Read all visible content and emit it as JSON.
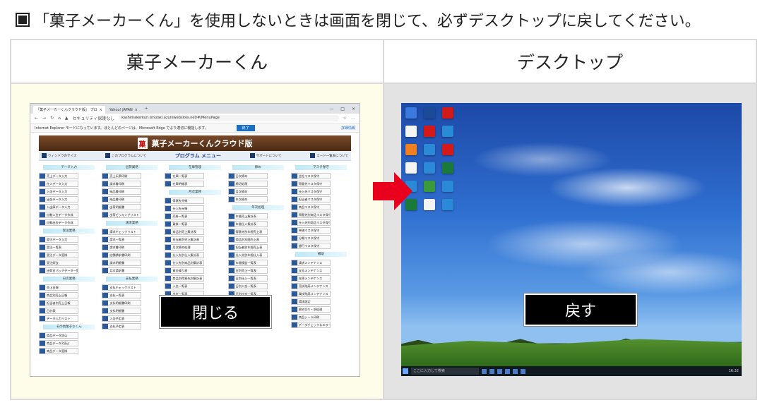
{
  "instruction": "「菓子メーカーくん」を使用しないときは画面を閉じて、必ずデスクトップに戻してください。",
  "table": {
    "left_header": "菓子メーカーくん",
    "right_header": "デスクトップ"
  },
  "browser": {
    "tabs": [
      "「菓子メーカーくんクラウド版」 プロ",
      "Yahoo! JAPAN"
    ],
    "security_label": "セキュリティ保護なし",
    "url": "kashimakerkun.ishizaki.azurewebsites.net/#/MenuPage",
    "ie_notice": "Internet Explorer モードになっています。ほとんどのページは、Microsoft Edge でより適切に機能します。",
    "ie_button": "終了",
    "ie_link": "詳細情報",
    "banner_title": "菓子メーカーくんクラウド版",
    "logo_char": "菓",
    "nav_items": [
      "ウィンドウのサイズ",
      "このプログラムについて",
      "プログラム メニュー",
      "サポートについて",
      "コード一覧表について"
    ],
    "columns": [
      {
        "sections": [
          {
            "title": "データ入力",
            "items": [
              "売上データ入力",
              "仕入データ入力",
              "入金データ入力",
              "出金データ入力",
              "入出庫データ入力",
              "自動入金データ作成",
              "自動出金データ作成"
            ]
          },
          {
            "title": "受注業務",
            "items": [
              "受注データ入力",
              "受注一覧表",
              "受注データ変換",
              "受注照会",
              "出荷日パッチデータ一覧"
            ]
          },
          {
            "title": "日次業務",
            "items": [
              "売上日報",
              "商品別売上日報",
              "担当者別売上日報",
              "日計表",
              "データ入力リスト"
            ]
          },
          {
            "title": "その他菓子なくん",
            "items": [
              "商品データ読込",
              "商品データ2読込",
              "商品データ変換"
            ]
          }
        ]
      },
      {
        "sections": [
          {
            "title": "出荷業務",
            "items": [
              "売上伝票印刷",
              "請求書印刷",
              "納品書印刷",
              "納品書印刷",
              "出荷明細書",
              "出荷ピッキングリスト"
            ]
          },
          {
            "title": "請求業務",
            "items": [
              "請求チェックリスト",
              "請求一覧表",
              "請求書印刷",
              "店舗請求書印刷",
              "請求明細書",
              "月次請求書"
            ]
          },
          {
            "title": "支払業務",
            "items": [
              "支払チェックリスト",
              "支払一覧表",
              "支払明細書印刷",
              "支払明細書",
              "入金予定表",
              "支払予定表"
            ]
          }
        ]
      },
      {
        "sections": [
          {
            "title": "在庫管理",
            "items": [
              "在庫一覧表",
              "在庫明細表"
            ]
          },
          {
            "title": "月次業務",
            "items": [
              "得意先元帳",
              "仕入先元帳",
              "売掛一覧表",
              "買掛一覧表",
              "商品別売上集計表",
              "担当者別売上集計表",
              "月次締め処理",
              "仕入先別仕入集計表",
              "仕入先別商品別集計表",
              "資金繰り表",
              "商品別得意先別集計表",
              "入金一覧表",
              "出金一覧表"
            ]
          }
        ]
      },
      {
        "sections": [
          {
            "title": "締め",
            "items": [
              "日次締め",
              "締切処理",
              "月次締め",
              "年次締め"
            ]
          },
          {
            "title": "年次処理",
            "items": [
              "年間売上集計表",
              "年間仕入集計表",
              "得意先別年間売上表",
              "商品別年間売上表",
              "担当者別年間売上表",
              "仕入先別年間仕入表",
              "年間損益一覧表",
              "日別売上一覧表",
              "日別仕入一覧表",
              "日別入金一覧表",
              "日別出金一覧表",
              "日別在庫一覧表",
              "日別入出庫一覧表"
            ]
          }
        ]
      },
      {
        "sections": [
          {
            "title": "マスタ保守",
            "items": [
              "会社マスタ保守",
              "得意先マスタ保守",
              "仕入先マスタ保守",
              "担当者マスタ保守",
              "商品マスタ保守",
              "得意先別商品マスタ保守",
              "仕入先別商品マスタ保守",
              "単価マスタ保守",
              "分類マスタ保守",
              "銀行マスタ保守"
            ]
          },
          {
            "title": "補助",
            "items": [
              "請求メンテナンス",
              "支払メンテナンス",
              "在庫メンテナンス",
              "売掛残高メンテナンス",
              "買掛残高メンテナンス",
              "環境設定",
              "締め切り・前処理",
              "商品シール印刷",
              "データチェック＆エラー処理"
            ]
          }
        ]
      }
    ]
  },
  "close_label": "閉じる",
  "return_label": "戻す",
  "desktop": {
    "search_placeholder": "ここに入力して検索",
    "clock": "16:32"
  },
  "colors": {
    "arrow": "#e8001c",
    "left_cell_bg": "#fdfde9",
    "right_cell_bg": "#e3e3e3",
    "border": "#d9d9d9"
  }
}
